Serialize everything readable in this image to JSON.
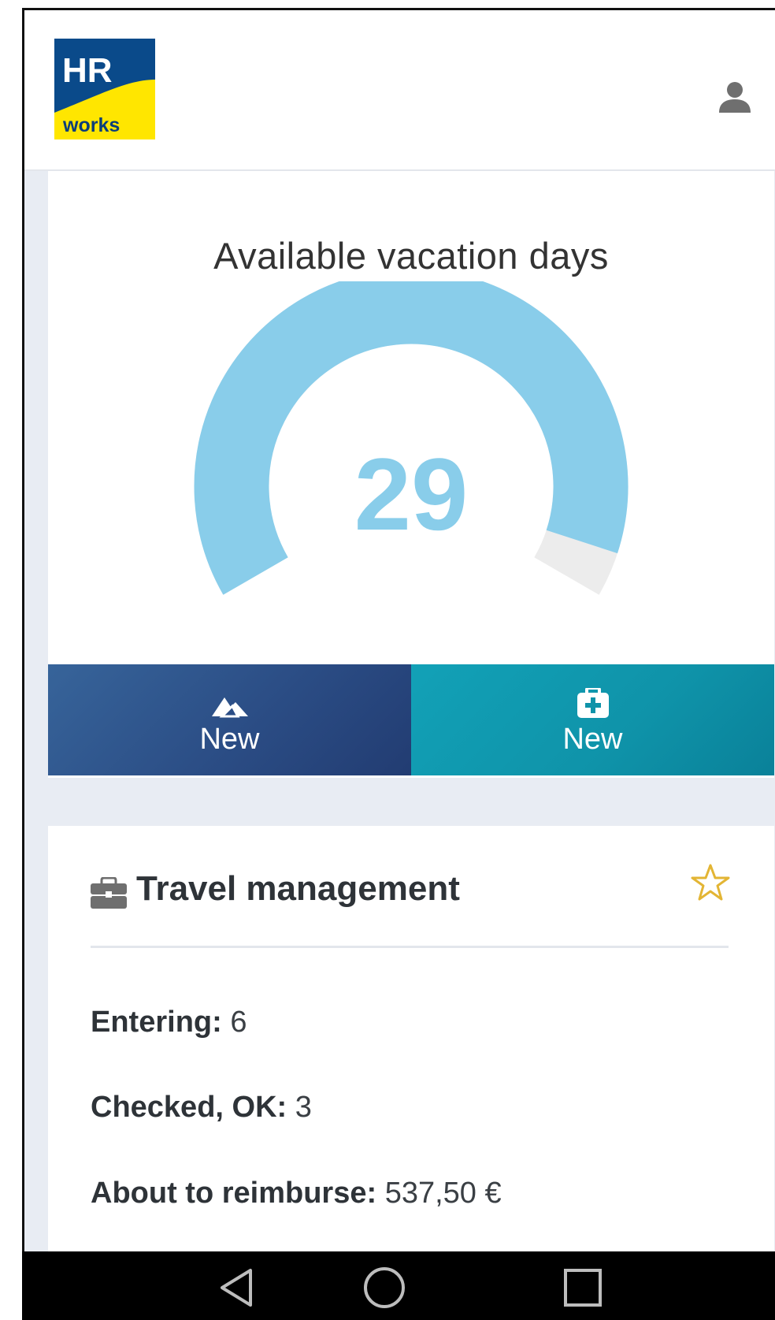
{
  "header": {
    "logo": {
      "text_top": "HR",
      "text_bottom": "works",
      "colors": {
        "blue": "#0a4a8a",
        "yellow": "#ffe600"
      }
    },
    "user_icon": "user-icon"
  },
  "vacation": {
    "title": "Available vacation days",
    "available_days": "29",
    "gauge": {
      "fill_fraction": 0.95,
      "color": "#89cdea",
      "track_color": "#ececec"
    },
    "buttons": [
      {
        "icon": "mountain-icon",
        "label": "New"
      },
      {
        "icon": "medical-kit-icon",
        "label": "New"
      }
    ]
  },
  "travel": {
    "icon": "briefcase-icon",
    "title": "Travel management",
    "favorite_icon": "star-icon",
    "stats": [
      {
        "label": "Entering:",
        "value": "6"
      },
      {
        "label": "Checked, OK:",
        "value": "3"
      },
      {
        "label": "About to reimburse:",
        "value": "537,50 €"
      }
    ]
  },
  "system_nav": [
    "back-icon",
    "home-icon",
    "recents-icon"
  ]
}
